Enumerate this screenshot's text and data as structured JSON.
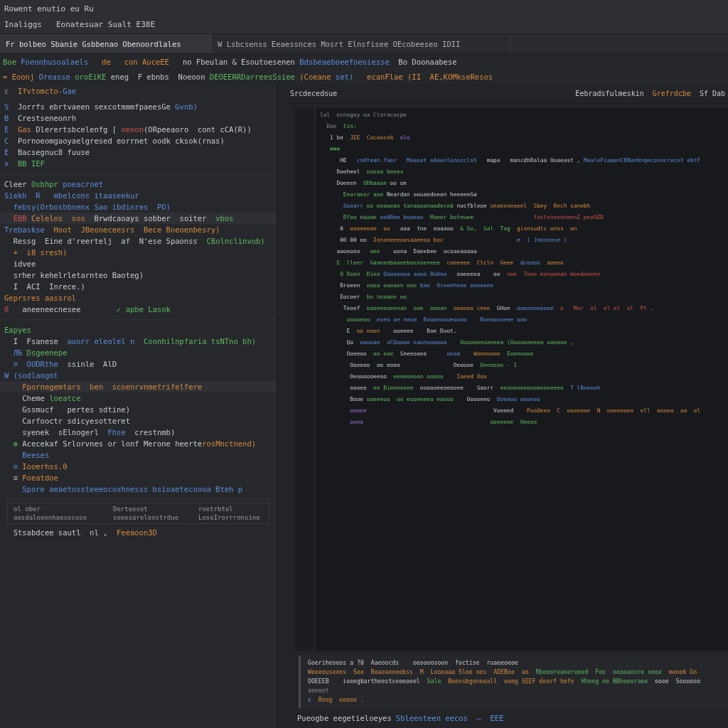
{
  "title_bar": {
    "title": "Rowent enutio eu Ru",
    "menu": "Inaliggs",
    "path": "Eonatesuar Sualt E38E"
  },
  "tabs": [
    {
      "label": "Fr bolbeo Sbanie Gsbbenao Obenoordlales",
      "selected": true
    },
    {
      "label": "W Lsbcsenss Eeaessnces Mosrt Elnsfisee OEcobeeseo IDII",
      "selected": false
    }
  ],
  "toolbar": [
    [
      {
        "text": "Boe ",
        "kind": "s"
      },
      {
        "text": "Foeonbusoalaels",
        "kind": "k"
      },
      {
        "text": "   de ",
        "kind": "o"
      },
      {
        "text": "  con ",
        "kind": "o"
      },
      {
        "text": "AuceEE",
        "kind": "o"
      },
      {
        "text": "   no Fbeulan & Esoutoesenen ",
        "kind": "t"
      },
      {
        "text": "Bdsbeaeboeefoeoiesse",
        "kind": "k"
      },
      {
        "text": "  Bo Doonaabese",
        "kind": "t"
      }
    ],
    [
      {
        "text": "= ",
        "kind": "o"
      },
      {
        "text": "Eoonj ",
        "kind": "o"
      },
      {
        "text": "Oreasse ",
        "kind": "k"
      },
      {
        "text": "oroEiKE ",
        "kind": "s"
      },
      {
        "text": "eneg  F ebnbs  Noeoon ",
        "kind": "t"
      },
      {
        "text": "DEOEERRDarreesSsiee ",
        "kind": "s"
      },
      {
        "text": "(Coeane ",
        "kind": "o"
      },
      {
        "text": "set) ",
        "kind": "k"
      },
      {
        "text": "  ecanFlae (II  ",
        "kind": "o"
      },
      {
        "text": "AE,KOMkseResos",
        "kind": "o"
      }
    ]
  ],
  "explorer": {
    "header": [
      {
        "text": "ε  ",
        "kind": "d"
      },
      {
        "text": "Ifvtomcto-",
        "kind": "o"
      },
      {
        "text": "Gae",
        "kind": "k"
      }
    ],
    "sections": [
      {
        "lines": [
          [
            {
              "text": "S  ",
              "kind": "k"
            },
            {
              "text": "Jorrfs ebrtvaeen sexcotmmmfpaeesGe ",
              "kind": "t"
            },
            {
              "text": "Gvnb)",
              "kind": "k"
            }
          ],
          [
            {
              "text": "B  ",
              "kind": "k"
            },
            {
              "text": "Crestseneonrh",
              "kind": "t"
            }
          ],
          [
            {
              "text": "E  ",
              "kind": "k"
            },
            {
              "text": "Gas ",
              "kind": "o"
            },
            {
              "text": "Dlerertsbcelenfg [ ",
              "kind": "t"
            },
            {
              "text": "oeoon",
              "kind": "r"
            },
            {
              "text": "(ORpeeaoro  cont cCA(R))",
              "kind": "t"
            }
          ],
          [
            {
              "text": "C  ",
              "kind": "k"
            },
            {
              "text": "Pornoeomgaoyaelgresed eorrnet oodk cksok(rnas)",
              "kind": "t"
            }
          ],
          [
            {
              "text": "E  ",
              "kind": "k"
            },
            {
              "text": "Bacsegnuc8 fuuse",
              "kind": "t"
            }
          ],
          [
            {
              "text": "x  ",
              "kind": "k"
            },
            {
              "text": "BB IEF",
              "kind": "s"
            }
          ]
        ]
      },
      {
        "lines": [
          [
            {
              "text": "Cleer ",
              "kind": "t"
            },
            {
              "text": "Osbhpr ",
              "kind": "s"
            },
            {
              "text": "poeacroet",
              "kind": "k"
            }
          ],
          [
            {
              "text": "Siekh  R   mbelcons itaaseekur",
              "kind": "k"
            }
          ],
          [
            {
              "text": "  febsy(Orbosbbnenx Sao ibdinres  PO)",
              "kind": "k"
            }
          ],
          [
            {
              "text": "  EBB ",
              "kind": "r"
            },
            {
              "text": "Celelos  sos  ",
              "kind": "o"
            },
            {
              "text": "Brwdcaoays sobber  soiter  ",
              "kind": "t"
            },
            {
              "text": "vbos",
              "kind": "s"
            }
          ],
          [
            {
              "text": "Trebaskse  ",
              "kind": "k"
            },
            {
              "text": "Hoot  JBeoneceesrs  Bece Boeoenbesry)",
              "kind": "o"
            }
          ],
          [
            {
              "text": "  Ressg  Eine d'reertelj  af  N'ese Spaonss  ",
              "kind": "t"
            },
            {
              "text": "CBolnclinvob)",
              "kind": "s"
            }
          ],
          [
            {
              "text": "  +  i8 sresh)",
              "kind": "o"
            }
          ],
          [
            {
              "text": "  idvee",
              "kind": "t"
            }
          ],
          [
            {
              "text": "  srher kehelrletarnteo Baoteg)",
              "kind": "t"
            }
          ],
          [
            {
              "text": "  I  ACI  Inrece.)",
              "kind": "t"
            }
          ],
          [
            {
              "text": "Geprsres aassrol",
              "kind": "o"
            }
          ],
          [
            {
              "text": "0   ",
              "kind": "r"
            },
            {
              "text": "aneeneecnesee        ",
              "kind": "t"
            },
            {
              "text": "✓ apbe Lasok",
              "kind": "s"
            }
          ]
        ]
      },
      {
        "lines": [
          [
            {
              "text": "Eapyes",
              "kind": "s"
            }
          ],
          [
            {
              "text": "  I  ",
              "kind": "t"
            },
            {
              "text": "Fsanese  ",
              "kind": "t"
            },
            {
              "text": "auorr eleolel n  ",
              "kind": "k"
            },
            {
              "text": "Coonhilnpfaria tsNTno bh)",
              "kind": "s"
            }
          ],
          [
            {
              "text": "  ЛБ ",
              "kind": "k"
            },
            {
              "text": "Dsgeenepe",
              "kind": "s"
            }
          ],
          [
            {
              "text": "  ≡  ",
              "kind": "k"
            },
            {
              "text": "OUDRthe  ",
              "kind": "k"
            },
            {
              "text": "ssinle  AlD",
              "kind": "t"
            }
          ],
          [
            {
              "text": "W (",
              "kind": "k"
            },
            {
              "text": "sodlaognt",
              "kind": "k"
            }
          ],
          [
            {
              "text": "    Fpornegemtars  ben  scoenrvnmetrifelfere",
              "kind": "o"
            }
          ],
          [
            {
              "text": "    Cheme ",
              "kind": "t"
            },
            {
              "text": "loeatce",
              "kind": "s"
            }
          ],
          [
            {
              "text": "    Gssmucf   pertes sdtine)",
              "kind": "t"
            }
          ],
          [
            {
              "text": "    Carfooctr sdicyesotteret",
              "kind": "t"
            }
          ],
          [
            {
              "text": "    syenek  sElnogerl  ",
              "kind": "t"
            },
            {
              "text": "Fhse  ",
              "kind": "k"
            },
            {
              "text": "crestnmb)",
              "kind": "t"
            }
          ],
          [
            {
              "text": "  ⊕ ",
              "kind": "s"
            },
            {
              "text": "Acecekaf Srlorvnes or lonf Merone heerte",
              "kind": "t"
            },
            {
              "text": "rosMnctnend)",
              "kind": "o"
            }
          ],
          [
            {
              "text": "    Beeses",
              "kind": "k"
            }
          ],
          [
            {
              "text": "  ≡ ",
              "kind": "k"
            },
            {
              "text": "Iooerhss.0",
              "kind": "o"
            }
          ],
          [
            {
              "text": "  ≡ ",
              "kind": "t"
            },
            {
              "text": "Foeatdoe",
              "kind": "o"
            }
          ],
          [
            {
              "text": "    Spore aeaetossteeeocoxhnesss bsioaetecoooa Bteh p",
              "kind": "k"
            }
          ]
        ]
      }
    ],
    "table": [
      [
        "ol ober",
        "Derteeset",
        "roetrbtel"
      ],
      [
        "aesdaleeonhaesesuse",
        "seeesareleostrdue",
        "LeseIrorrronsine"
      ]
    ],
    "footer": [
      {
        "text": "  Stsabdcee sautl  nl ,  ",
        "kind": "t"
      },
      {
        "text": "Feeaoon3D",
        "kind": "o"
      }
    ]
  },
  "editor": {
    "title": "Srcdecedsue",
    "actions": [
      "Eebradsfulmeskin",
      "Grefrdcbe",
      "Sf Dab"
    ],
    "lines": [
      [
        {
          "text": "lal  ecnogoy oa Ctaracocpe",
          "kind": "d"
        }
      ],
      [
        {
          "text": "  Doe  ",
          "kind": "d"
        },
        {
          "text": "tin:",
          "kind": "s"
        }
      ],
      [
        {
          "text": "   1 be  ",
          "kind": "t"
        },
        {
          "text": "JEE  Cacoeceb  ",
          "kind": "o"
        },
        {
          "text": "olo",
          "kind": "p"
        }
      ],
      [
        {
          "text": "   ≡≡≡",
          "kind": "s"
        }
      ],
      [
        {
          "text": "      HE   ",
          "kind": "t"
        },
        {
          "text": "cnOtean.faer ",
          "kind": "k"
        },
        {
          "text": "  Maaoat eAoonlonocclsh ",
          "kind": "k"
        },
        {
          "text": "  mapa   mancdhBalaa Ooaeast , ",
          "kind": "t"
        },
        {
          "text": "MaaleFcaaanCBBanhnqecosncrecnt ebtF",
          "kind": "k"
        }
      ],
      [
        {
          "text": "     Boeheel  ",
          "kind": "t"
        },
        {
          "text": "oooaa beees",
          "kind": "s"
        }
      ],
      [
        {
          "text": "     Doeeen  ",
          "kind": "t"
        },
        {
          "text": "ODbaaan ",
          "kind": "s"
        },
        {
          "text": "oo oe",
          "kind": "t"
        }
      ],
      [
        {
          "text": "       Eeoraeor aoe ",
          "kind": "s"
        },
        {
          "text": "Neardan oouaedoeon heeeeeGa ",
          "kind": "t"
        }
      ],
      [
        {
          "text": "       Sooarr ",
          "kind": "k"
        },
        {
          "text": "oo eoaoean tanaooanaadeced ",
          "kind": "s"
        },
        {
          "text": "nocfbleoe ",
          "kind": "t"
        },
        {
          "text": "unaesneoeel  Sbey  Bech sanebh",
          "kind": "o"
        }
      ],
      [
        {
          "text": "       Bfoo eaaae ",
          "kind": "s"
        },
        {
          "text": "oo00oe boaeoo  ",
          "kind": "k"
        },
        {
          "text": "Maeor boteuee ",
          "kind": "s"
        },
        {
          "text": "                 fuctsnsesneenI peoGED",
          "kind": "r"
        }
      ],
      [
        {
          "text": "      0  ",
          "kind": "t"
        },
        {
          "text": "ooeeeean  oo ",
          "kind": "o"
        },
        {
          "text": "  aaa  tne  ",
          "kind": "t"
        },
        {
          "text": "eaaaoo",
          "kind": "t"
        },
        {
          "text": "  & Su,  Sal  Tag  ",
          "kind": "s"
        },
        {
          "text": "gisnsudtc onss  on",
          "kind": "o"
        }
      ],
      [
        {
          "text": "      00 00 oo  ",
          "kind": "t"
        },
        {
          "text": "Ionaneeeoasaaeeoa boc ",
          "kind": "o"
        },
        {
          "text": "                     e  ( Jnonoose )",
          "kind": "k"
        }
      ],
      [
        {
          "text": "     aooeoeo   ",
          "kind": "t"
        },
        {
          "text": "oee  ",
          "kind": "s"
        },
        {
          "text": "  oona  Daeebee  acoaeaaaaa",
          "kind": "t"
        }
      ],
      [
        {
          "text": "     E  lleer  ",
          "kind": "s"
        },
        {
          "text": "Gaaeeebaaeeboesoeneee  ",
          "kind": "s"
        },
        {
          "text": "coeeeee  Ctcln  Geee",
          "kind": "o"
        },
        {
          "text": "  dceooo  ",
          "kind": "k"
        },
        {
          "text": "aoeeo ",
          "kind": "o"
        }
      ],
      [
        {
          "text": "      Q Doon  Dieo ",
          "kind": "s"
        },
        {
          "text": "Oaaaoooa aooo Bo0oo ",
          "kind": "k"
        },
        {
          "text": "  ooeeeoa  ",
          "kind": "t"
        },
        {
          "text": "  oo  ",
          "kind": "t"
        },
        {
          "text": "noe  Tnoe eonooean moedooeen",
          "kind": "r"
        }
      ],
      [
        {
          "text": "      Broeen  ",
          "kind": "t"
        },
        {
          "text": "oooa oaeoen ooe ",
          "kind": "s"
        },
        {
          "text": "bae  Oreeehene ooeeeee",
          "kind": "k"
        }
      ],
      [
        {
          "text": "      Eocoer  ",
          "kind": "t"
        },
        {
          "text": "bo noaaon eo ",
          "kind": "s"
        }
      ],
      [
        {
          "text": "       Teoef  ",
          "kind": "t"
        },
        {
          "text": "oooeeooeenan  ooe  oeoae  ",
          "kind": "s"
        },
        {
          "text": "oooeoo cnee  ",
          "kind": "o"
        },
        {
          "text": "GHoe  ",
          "kind": "t"
        },
        {
          "text": "ooooeoeoooe  ",
          "kind": "k"
        },
        {
          "text": "o   Mor  al  el el  ol  Pt ,",
          "kind": "r"
        }
      ],
      [
        {
          "text": "        ooooeoo  ",
          "kind": "s"
        },
        {
          "text": "eoeo oe neoe  Boooeoooeoooo  ",
          "kind": "k"
        },
        {
          "text": "  Boeooooeee ooo",
          "kind": "k"
        }
      ],
      [
        {
          "text": "        E  ",
          "kind": "t"
        },
        {
          "text": "oo eoon  ",
          "kind": "o"
        },
        {
          "text": "  ooeeee  ",
          "kind": "t"
        },
        {
          "text": "  Boe Doot.",
          "kind": "t"
        }
      ],
      [
        {
          "text": "        Qo  ",
          "kind": "t"
        },
        {
          "text": "ooooae  xCQoooo eaonoooooa  ",
          "kind": "k"
        },
        {
          "text": "  Oooooeeoaeeea (Ooooooeeea ooeooe ,",
          "kind": "s"
        }
      ],
      [
        {
          "text": "        Ooeeoo  ",
          "kind": "t"
        },
        {
          "text": "oo eoe  ",
          "kind": "s"
        },
        {
          "text": "Sneeooee  ",
          "kind": "t"
        },
        {
          "text": "    oeoa  ",
          "kind": "k"
        },
        {
          "text": "  Woonooee  ",
          "kind": "o"
        },
        {
          "text": "Eoonoooe",
          "kind": "s"
        }
      ],
      [
        {
          "text": "         Ooeeoo  ",
          "kind": "t"
        },
        {
          "text": "oe eoeo  ",
          "kind": "t"
        },
        {
          "text": "              Oeoooe  ",
          "kind": "t"
        },
        {
          "text": "Oeeoooe - 1",
          "kind": "s"
        }
      ],
      [
        {
          "text": "         Oeoooooeeoo  ",
          "kind": "t"
        },
        {
          "text": "eeoeoeooo ooooo  ",
          "kind": "s"
        },
        {
          "text": "  Ioeed Ooo",
          "kind": "o"
        }
      ],
      [
        {
          "text": "         oooeo  ",
          "kind": "t"
        },
        {
          "text": "oo Bieeoeoee  ",
          "kind": "s"
        },
        {
          "text": "oooooeeoeooee  ",
          "kind": "t"
        },
        {
          "text": "  Saorr  ",
          "kind": "t"
        },
        {
          "text": "eeooeoeooeoeooeoeeo  ",
          "kind": "s"
        },
        {
          "text": "T lBoeeoh",
          "kind": "k"
        }
      ],
      [
        {
          "text": "         Booe ",
          "kind": "t"
        },
        {
          "text": "ooeeeoo  oo eooeeeeo eoooo  ",
          "kind": "s"
        },
        {
          "text": "  Ooooeeo ",
          "kind": "t"
        },
        {
          "text": " Ooeeoo oooeeo",
          "kind": "k"
        }
      ],
      [
        {
          "text": "         ooeee  ",
          "kind": "p"
        },
        {
          "text": "                                    Voeeed ",
          "kind": "t"
        },
        {
          "text": "   PooOeeo  C  ooeeooe  N  ooeeooeo  ell  oooeo  oo  ol",
          "kind": "o"
        }
      ],
      [
        {
          "text": "         ooeo  ",
          "kind": "p"
        },
        {
          "text": "                                    ooeeoee  Oeeoo",
          "kind": "s"
        }
      ]
    ]
  },
  "output": {
    "lines": [
      [
        {
          "text": "Goeriheoeos a ?0  ",
          "kind": "t"
        },
        {
          "text": "Aaeoocds  ",
          "kind": "t"
        },
        {
          "text": "  oeoooosoon  foctise  ruaeeoeoe",
          "kind": "t"
        }
      ],
      [
        {
          "text": "Weeeouseeos  ",
          "kind": "o"
        },
        {
          "text": "See  Boaeaeeeebss  M  ",
          "kind": "o"
        },
        {
          "text": "Looeaaa Sloe oos  ",
          "kind": "o"
        },
        {
          "text": "ADEBoe  ae  ",
          "kind": "o"
        },
        {
          "text": "Rbeeoreanereeed  Foe  oooeaeore eooe  ",
          "kind": "s"
        },
        {
          "text": "meoek Gn",
          "kind": "o"
        }
      ],
      [
        {
          "text": "OOEEEB  ",
          "kind": "t"
        },
        {
          "text": "  ioeegbartheestseoeoeel  ",
          "kind": "t"
        },
        {
          "text": "Sale  ",
          "kind": "s"
        },
        {
          "text": "Boonsbgeneeall  ",
          "kind": "o"
        },
        {
          "text": "eoeg SEEF doorf hofe  ",
          "kind": "o"
        },
        {
          "text": "Hheeg ne BBheeoraee  ",
          "kind": "s"
        },
        {
          "text": "ooee  Soooeoo",
          "kind": "t"
        }
      ],
      [
        {
          "text": "aeeeet",
          "kind": "d"
        }
      ],
      [
        {
          "text": "ε  ",
          "kind": "k"
        },
        {
          "text": "Boeg  eeeee .",
          "kind": "o"
        }
      ]
    ]
  },
  "status_bar": {
    "text": "Pueogbe eegetieloeyes",
    "tail": "Sbleeoteen eecos  —  EEE"
  }
}
